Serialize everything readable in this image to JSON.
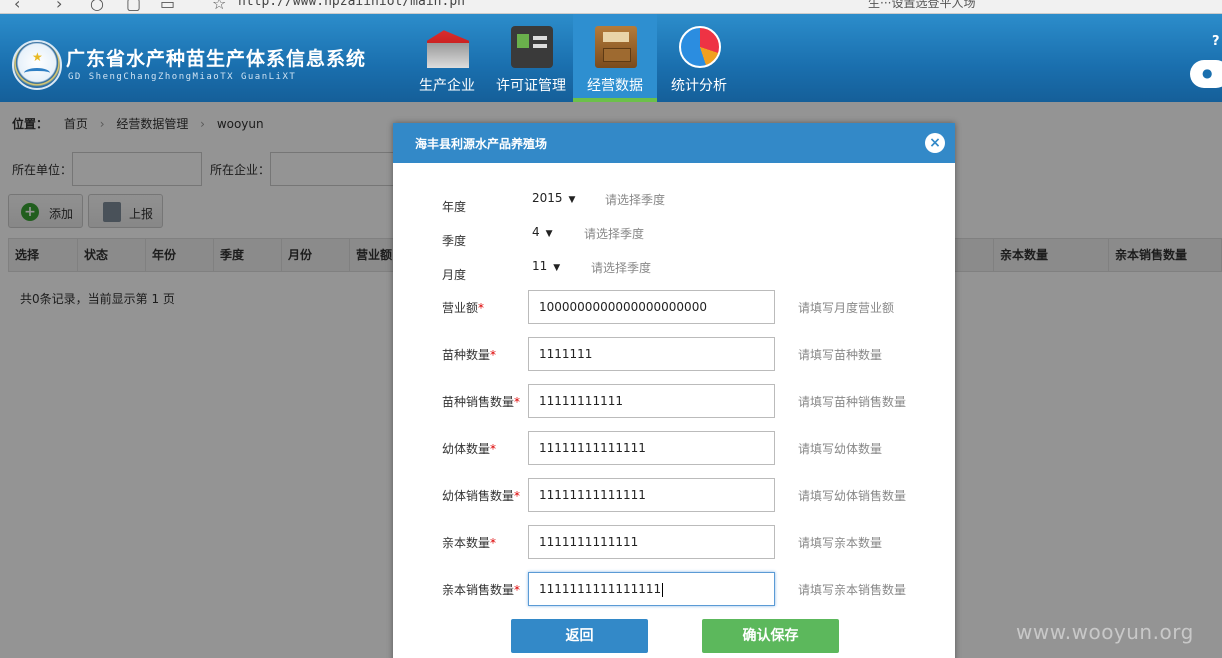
{
  "browser": {
    "url": "http://www.hpzaiiniot/main.ph",
    "tab_title": "生···设置选登平人场"
  },
  "header": {
    "system_title": "广东省水产种苗生产体系信息系统",
    "system_subtitle": "GD ShengChangZhongMiaoTX GuanLiXT",
    "help": "?",
    "nav": [
      {
        "label": "生产企业",
        "icon": "factory-icon"
      },
      {
        "label": "许可证管理",
        "icon": "license-icon"
      },
      {
        "label": "经营数据",
        "icon": "cabinet-icon",
        "active": true
      },
      {
        "label": "统计分析",
        "icon": "pie-chart-icon"
      }
    ]
  },
  "breadcrumb": {
    "label": "位置：",
    "items": [
      "首页",
      "经营数据管理",
      "wooyun"
    ]
  },
  "filters": {
    "unit_label": "所在单位：",
    "enterprise_label": "所在企业："
  },
  "toolbar": {
    "add_label": "添加",
    "report_label": "上报"
  },
  "grid": {
    "columns": [
      "选择",
      "状态",
      "年份",
      "季度",
      "月份",
      "营业额",
      "亲本数量",
      "亲本销售数量"
    ]
  },
  "record_info": "共0条记录，当前显示第 1 页",
  "modal": {
    "title": "海丰县利源水产品养殖场",
    "year": {
      "label": "年度",
      "value": "2015",
      "hint": "请选择季度"
    },
    "quarter": {
      "label": "季度",
      "value": "4",
      "hint": "请选择季度"
    },
    "month": {
      "label": "月度",
      "value": "11",
      "hint": "请选择季度"
    },
    "fields": [
      {
        "label": "营业额",
        "required": "*",
        "value": "1000000000000000000000",
        "hint": "请填写月度营业额"
      },
      {
        "label": "苗种数量",
        "required": "*",
        "value": "1111111",
        "hint": "请填写苗种数量"
      },
      {
        "label": "苗种销售数量",
        "required": "*",
        "value": "11111111111",
        "hint": "请填写苗种销售数量"
      },
      {
        "label": "幼体数量",
        "required": "*",
        "value": "11111111111111",
        "hint": "请填写幼体数量"
      },
      {
        "label": "幼体销售数量",
        "required": "*",
        "value": "11111111111111",
        "hint": "请填写幼体销售数量"
      },
      {
        "label": "亲本数量",
        "required": "*",
        "value": "1111111111111",
        "hint": "请填写亲本数量"
      },
      {
        "label": "亲本销售数量",
        "required": "*",
        "value": "1111111111111111",
        "hint": "请填写亲本销售数量"
      }
    ],
    "back_label": "返回",
    "save_label": "确认保存"
  },
  "watermark": "www.wooyun.org",
  "colors": {
    "header": "#1a6fae",
    "modal_header": "#3389c8",
    "save_button": "#5cb85c",
    "active_tab_underline": "#6cc04a"
  }
}
